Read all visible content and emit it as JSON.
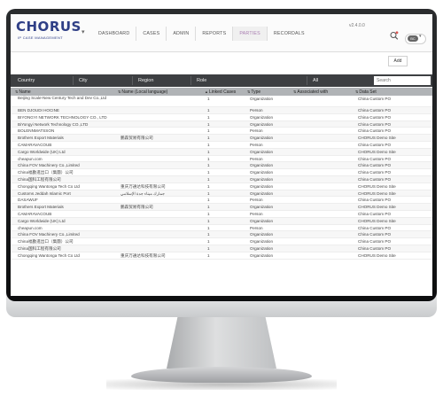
{
  "app": {
    "logo_text": "CHORUS",
    "logo_subtitle": "IP CASE MANAGEMENT",
    "version": "v2.4.0.0",
    "user_initials": "BC",
    "add_label": "Add"
  },
  "nav": [
    "DASHBOARD",
    "CASES",
    "ADMIN",
    "REPORTS",
    "PARTIES",
    "RECORDALS"
  ],
  "nav_active": "PARTIES",
  "filters": {
    "country": "Country",
    "city": "City",
    "region": "Region",
    "role": "Role",
    "all": "All",
    "search_placeholder": "Search"
  },
  "columns": [
    "Name",
    "Name (Local language)",
    "Linked Cases",
    "Type",
    "Associated with",
    "Data Set"
  ],
  "rows": [
    {
      "name": "Beijing Scale-New Century Tech and Dev Co.,Ltd",
      "local": "",
      "count": "1",
      "type": "Organization",
      "assoc": "",
      "set": "China Custom PO"
    },
    {
      "name": "BEN DJOUDI HOCINE",
      "local": "",
      "count": "1",
      "type": "Person",
      "assoc": "",
      "set": "China Custom PO"
    },
    {
      "name": "BIYONGYI NETWORK TECHNOLOGY CO., LTD",
      "local": "",
      "count": "1",
      "type": "Organization",
      "assoc": "",
      "set": "China Custom PO"
    },
    {
      "name": "BiYongyi Network Technology CO.,LTD",
      "local": "",
      "count": "1",
      "type": "Organization",
      "assoc": "",
      "set": "China Custom PO"
    },
    {
      "name": "BOLENNMATSSON",
      "local": "",
      "count": "1",
      "type": "Person",
      "assoc": "",
      "set": "China Custom PO"
    },
    {
      "name": "Brothers Export Materials",
      "local": "鹏森贸易有限公司",
      "count": "1",
      "type": "Organization",
      "assoc": "",
      "set": "CHORUS Demo Site"
    },
    {
      "name": "CAMARAVACOUB",
      "local": "",
      "count": "1",
      "type": "Person",
      "assoc": "",
      "set": "China Custom PO"
    },
    {
      "name": "Cargo Worldwide (UK) Ltd",
      "local": "",
      "count": "1",
      "type": "Organization",
      "assoc": "",
      "set": "CHORUS Demo Site"
    },
    {
      "name": "cheapun.com",
      "local": "",
      "count": "1",
      "type": "Person",
      "assoc": "",
      "set": "China Custom PO"
    },
    {
      "name": "China FOV Machinery Co.,Limited",
      "local": "",
      "count": "1",
      "type": "Organization",
      "assoc": "",
      "set": "China Custom PO"
    },
    {
      "name": "China福勤進出口（集團）公司",
      "local": "",
      "count": "1",
      "type": "Organization",
      "assoc": "",
      "set": "China Custom PO"
    },
    {
      "name": "China国科工程有限公司",
      "local": "",
      "count": "1",
      "type": "Organization",
      "assoc": "",
      "set": "China Custom PO"
    },
    {
      "name": "Chongqing Wantonga Tech Co Ltd",
      "local": "重庆万通达科技有限公司",
      "count": "1",
      "type": "Organization",
      "assoc": "",
      "set": "CHORUS Demo Site"
    },
    {
      "name": "Customs Jeddah Islamic Port",
      "local": "جمارك ميناء جدة الإسلامي",
      "count": "1",
      "type": "Organization",
      "assoc": "",
      "set": "CHORUS Demo Site"
    },
    {
      "name": "DASAWUF",
      "local": "",
      "count": "1",
      "type": "Person",
      "assoc": "",
      "set": "China Custom PO"
    },
    {
      "name": "Brothers Export Materials",
      "local": "鹏森贸易有限公司",
      "count": "1",
      "type": "Organization",
      "assoc": "",
      "set": "CHORUS Demo Site"
    },
    {
      "name": "CAMARAVACOUB",
      "local": "",
      "count": "1",
      "type": "Person",
      "assoc": "",
      "set": "China Custom PO"
    },
    {
      "name": "Cargo Worldwide (UK) Ltd",
      "local": "",
      "count": "1",
      "type": "Organization",
      "assoc": "",
      "set": "CHORUS Demo Site"
    },
    {
      "name": "cheapun.com",
      "local": "",
      "count": "1",
      "type": "Person",
      "assoc": "",
      "set": "China Custom PO"
    },
    {
      "name": "China FOV Machinery Co.,Limited",
      "local": "",
      "count": "1",
      "type": "Organization",
      "assoc": "",
      "set": "China Custom PO"
    },
    {
      "name": "China福勤進出口（集團）公司",
      "local": "",
      "count": "1",
      "type": "Organization",
      "assoc": "",
      "set": "China Custom PO"
    },
    {
      "name": "China国科工程有限公司",
      "local": "",
      "count": "1",
      "type": "Organization",
      "assoc": "",
      "set": "China Custom PO"
    },
    {
      "name": "Chongqing Wantonga Tech Co Ltd",
      "local": "重庆万通达科技有限公司",
      "count": "1",
      "type": "Organization",
      "assoc": "",
      "set": "CHORUS Demo Site"
    }
  ]
}
